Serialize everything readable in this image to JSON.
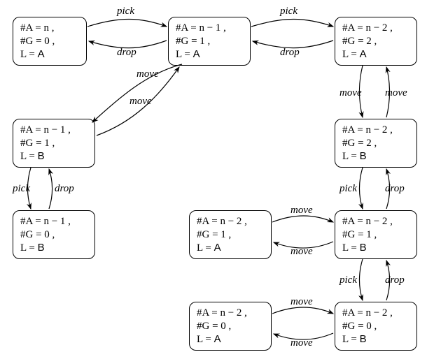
{
  "labels": {
    "pick": "pick",
    "drop": "drop",
    "move": "move"
  },
  "nodes": {
    "s1": {
      "a": "#A = n ,",
      "g": "#G = 0 ,",
      "l_prefix": "L = ",
      "l_val": "A"
    },
    "s2": {
      "a": "#A = n − 1 ,",
      "g": "#G = 1 ,",
      "l_prefix": "L = ",
      "l_val": "A"
    },
    "s3": {
      "a": "#A = n − 2 ,",
      "g": "#G = 2 ,",
      "l_prefix": "L = ",
      "l_val": "A"
    },
    "s4": {
      "a": "#A = n − 1 ,",
      "g": "#G = 1 ,",
      "l_prefix": "L = ",
      "l_val": "B"
    },
    "s5": {
      "a": "#A = n − 1 ,",
      "g": "#G = 0 ,",
      "l_prefix": "L = ",
      "l_val": "B"
    },
    "s6": {
      "a": "#A = n − 2 ,",
      "g": "#G = 2 ,",
      "l_prefix": "L = ",
      "l_val": "B"
    },
    "s7": {
      "a": "#A = n − 2 ,",
      "g": "#G = 1 ,",
      "l_prefix": "L = ",
      "l_val": "A"
    },
    "s8": {
      "a": "#A = n − 2 ,",
      "g": "#G = 1 ,",
      "l_prefix": "L = ",
      "l_val": "B"
    },
    "s9": {
      "a": "#A = n − 2 ,",
      "g": "#G = 0 ,",
      "l_prefix": "L = ",
      "l_val": "A"
    },
    "s10": {
      "a": "#A = n − 2 ,",
      "g": "#G = 0 ,",
      "l_prefix": "L = ",
      "l_val": "B"
    }
  },
  "edge_labels": {
    "e12_top": "pick",
    "e12_bot": "drop",
    "e23_top": "pick",
    "e23_bot": "drop",
    "e24_top": "move",
    "e24_bot": "move",
    "e45_l": "pick",
    "e45_r": "drop",
    "e36_l": "move",
    "e36_r": "move",
    "e68_l": "pick",
    "e68_r": "drop",
    "e78_top": "move",
    "e78_bot": "move",
    "e810_l": "pick",
    "e810_r": "drop",
    "e910_top": "move",
    "e910_bot": "move"
  }
}
